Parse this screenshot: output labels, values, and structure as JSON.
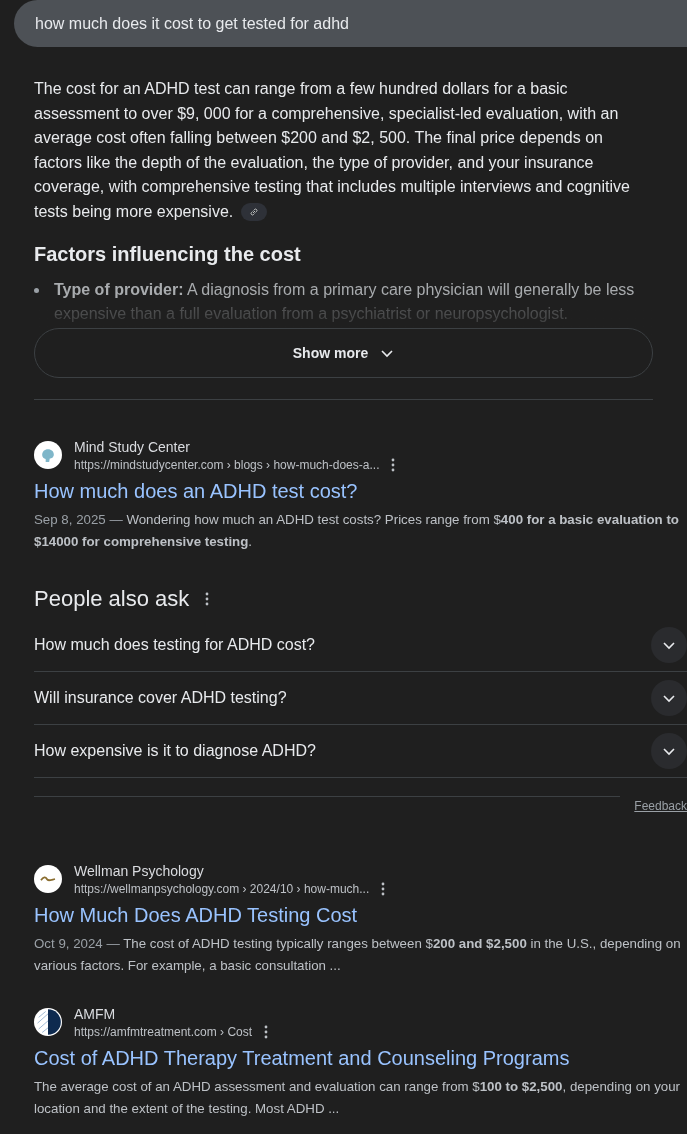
{
  "search": {
    "value": "how much does it cost to get tested for adhd"
  },
  "overview": {
    "paragraph": "The cost for an ADHD test can range from a few hundred dollars for a basic assessment to over $9, 000 for a comprehensive, specialist-led evaluation, with an average cost often falling between $200 and $2, 500. The final price depends on factors like the depth of the evaluation, the type of provider, and your insurance coverage, with comprehensive testing that includes multiple interviews and cognitive tests being more expensive.",
    "heading": "Factors influencing the cost",
    "bullets": [
      {
        "text": "**Type of provider:** A diagnosis from a primary care physician will generally be less expensive than a full evaluation from a psychiatrist or neuropsychologist."
      }
    ],
    "show_more": "Show more"
  },
  "results_top": [
    {
      "site": "Mind Study Center",
      "url": "https://mindstudycenter.com › blogs › how-much-does-a...",
      "title": "How much does an ADHD test cost?",
      "date": "Sep 8, 2025 —",
      "snippet": "Wondering how much an ADHD test costs? Prices range from $**400 for a basic evaluation to $14000 for comprehensive testing**.",
      "kind": "brain"
    }
  ],
  "people_also_ask": {
    "title": "People also ask",
    "questions": [
      {
        "text": "How much does testing for ADHD cost?",
        "expanded": false
      },
      {
        "text": "Will insurance cover ADHD testing?",
        "expanded": false
      },
      {
        "text": "How expensive is it to diagnose ADHD?",
        "expanded": false
      }
    ],
    "feedback": "Feedback"
  },
  "results": [
    {
      "site": "Wellman Psychology",
      "url": "https://wellmanpsychology.com › 2024/10 › how-much...",
      "title": "How Much Does ADHD Testing Cost",
      "date": "Oct 9, 2024 —",
      "snippet": "The cost of ADHD testing typically ranges between $**200 and $2,500** in the U.S., depending on various factors. For example, a basic consultation ...",
      "kind": "script"
    },
    {
      "site": "AMFM",
      "url": "https://amfmtreatment.com › Cost",
      "title": "Cost of ADHD Therapy Treatment and Counseling Programs",
      "snippet": "The average cost of an ADHD assessment and evaluation can range from $**100 to $2,500**, depending on your location and the extent of the testing. Most ADHD ...",
      "kind": "half"
    }
  ]
}
